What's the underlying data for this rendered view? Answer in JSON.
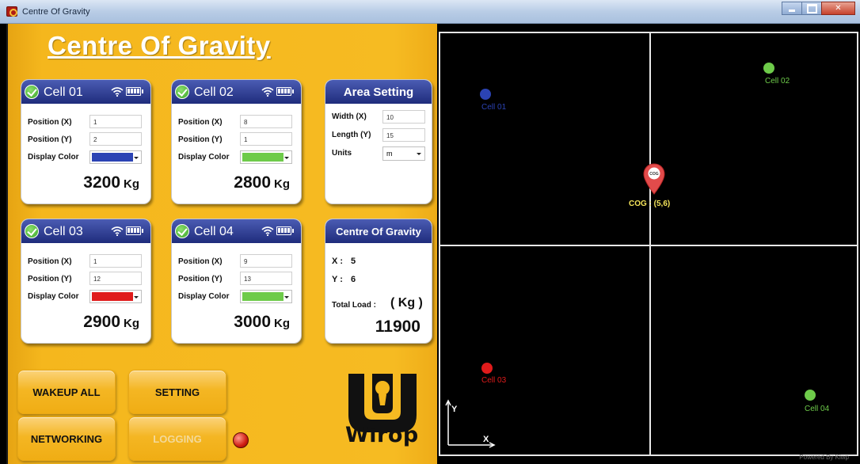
{
  "window": {
    "title": "Centre Of Gravity"
  },
  "app": {
    "heading": "Centre Of Gravity"
  },
  "cells": [
    {
      "title": "Cell 01",
      "pos_x_label": "Position  (X)",
      "pos_x": "1",
      "pos_y_label": "Position  (Y)",
      "pos_y": "2",
      "color_label": "Display Color",
      "color": "#2b43b4",
      "weight": "3200",
      "unit": "Kg"
    },
    {
      "title": "Cell 02",
      "pos_x_label": "Position  (X)",
      "pos_x": "8",
      "pos_y_label": "Position  (Y)",
      "pos_y": "1",
      "color_label": "Display Color",
      "color": "#6ecb4a",
      "weight": "2800",
      "unit": "Kg"
    },
    {
      "title": "Cell 03",
      "pos_x_label": "Position  (X)",
      "pos_x": "1",
      "pos_y_label": "Position  (Y)",
      "pos_y": "12",
      "color_label": "Display Color",
      "color": "#e01b1b",
      "weight": "2900",
      "unit": "Kg"
    },
    {
      "title": "Cell 04",
      "pos_x_label": "Position  (X)",
      "pos_x": "9",
      "pos_y_label": "Position  (Y)",
      "pos_y": "13",
      "color_label": "Display Color",
      "color": "#6ecb4a",
      "weight": "3000",
      "unit": "Kg"
    }
  ],
  "area": {
    "title": "Area  Setting",
    "width_label": "Width  (X)",
    "width": "10",
    "length_label": "Length  (Y)",
    "length": "15",
    "units_label": "Units",
    "units": "m"
  },
  "cog": {
    "title": "Centre Of Gravity",
    "x_label": "X :",
    "x": "5",
    "y_label": "Y :",
    "y": "6",
    "total_label": "Total Load :",
    "total_unit": "( Kg )",
    "total": "11900"
  },
  "buttons": {
    "wakeup": "WAKEUP ALL",
    "setting": "SETTING",
    "networking": "NETWORKING",
    "logging": "LOGGING"
  },
  "logo_text": "Wirop",
  "plot": {
    "labels": [
      "Cell 01",
      "Cell 02",
      "Cell 03",
      "Cell 04"
    ],
    "cog_badge": "COG",
    "cog_label": "COG : (5,6)",
    "axis_x": "X",
    "axis_y": "Y",
    "powered_by": "Powered By  Kiwp"
  },
  "icons": {
    "check": "check-circle-icon",
    "wifi": "wifi-icon",
    "battery": "battery-icon",
    "pin": "map-pin-icon"
  }
}
